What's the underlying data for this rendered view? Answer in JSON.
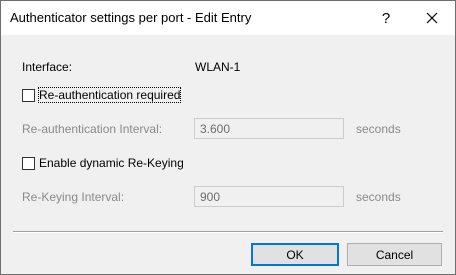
{
  "window": {
    "title": "Authenticator settings per port - Edit Entry",
    "help_glyph": "?",
    "close_icon": "close-icon"
  },
  "interface": {
    "label": "Interface:",
    "value": "WLAN-1"
  },
  "reauth": {
    "checkbox_label": "Re-authentication required",
    "checked": false,
    "interval_label": "Re-authentication Interval:",
    "interval_value": "3.600",
    "interval_unit": "seconds"
  },
  "rekey": {
    "checkbox_label": "Enable dynamic Re-Keying",
    "checked": false,
    "interval_label": "Re-Keying Interval:",
    "interval_value": "900",
    "interval_unit": "seconds"
  },
  "buttons": {
    "ok_label": "OK",
    "cancel_label": "Cancel"
  },
  "colors": {
    "default_button_border": "#0078d7",
    "client_background": "#f0f0f0",
    "disabled_text": "#8a8a8a"
  }
}
